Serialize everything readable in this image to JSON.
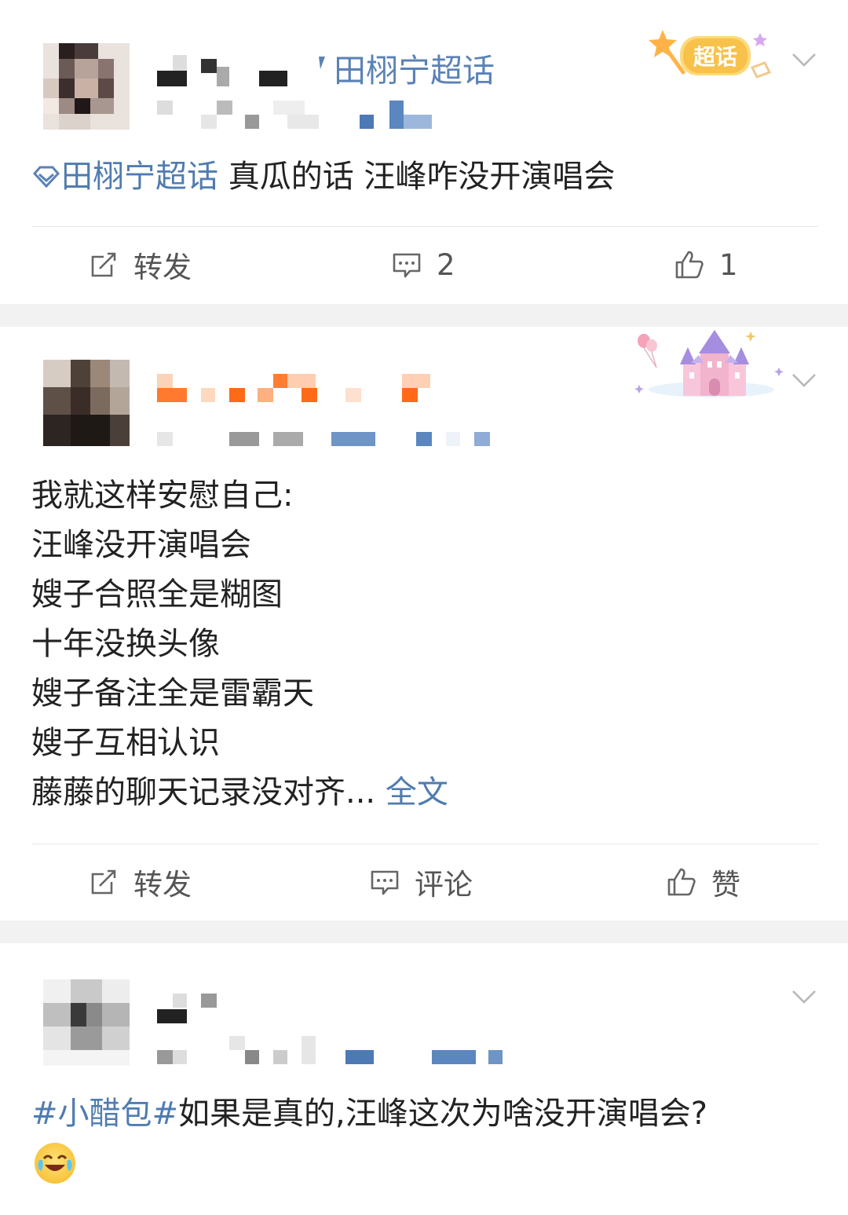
{
  "posts": [
    {
      "super_topic_name": "田栩宁超话",
      "badge_label": "超话",
      "topic_link": "田栩宁超话",
      "body": "真瓜的话 汪峰咋没开演唱会",
      "actions": {
        "repost": "转发",
        "comment": "2",
        "like": "1"
      }
    },
    {
      "body_lines": [
        "我就这样安慰自己:",
        "汪峰没开演唱会",
        "嫂子合照全是糊图",
        "十年没换头像",
        "嫂子备注全是雷霸天",
        "嫂子互相认识"
      ],
      "last_line": "藤藤的聊天记录没对齐...",
      "full_text": "全文",
      "actions": {
        "repost": "转发",
        "comment": "评论",
        "like": "赞"
      }
    },
    {
      "hashtag": "#小醋包#",
      "body": "如果是真的,汪峰这次为啥没开演唱会?"
    }
  ],
  "icons": {
    "repost": "repost-icon",
    "comment": "comment-icon",
    "like": "thumbs-up-icon",
    "more": "chevron-down-icon",
    "topic": "super-topic-diamond-icon",
    "emoji": "crying-laughing-emoji"
  },
  "colors": {
    "link": "#4f7cb0",
    "text": "#222222",
    "separator": "#f2f2f2"
  }
}
